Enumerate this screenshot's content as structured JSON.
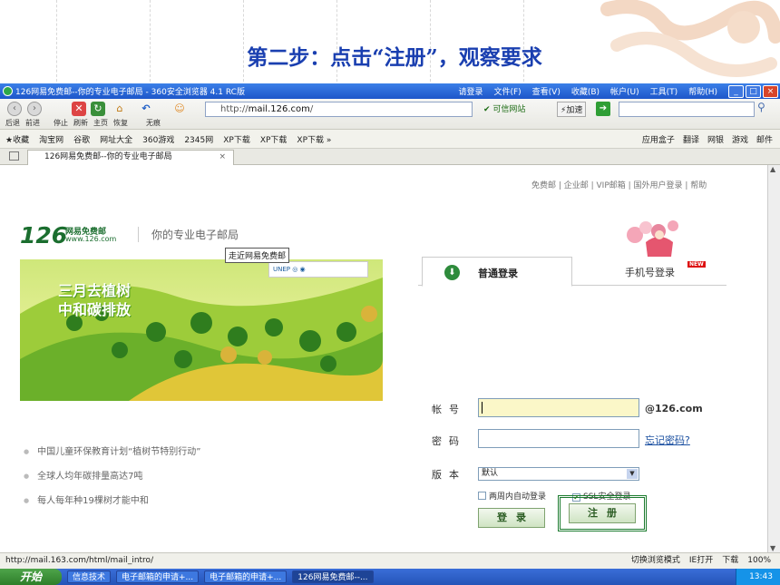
{
  "slide": {
    "title": "第二步：点击“注册”，观察要求"
  },
  "browser": {
    "window_title": "126网易免费邮--你的专业电子邮局 - 360安全浏览器 4.1 RC版",
    "menu": [
      "请登录",
      "文件(F)",
      "查看(V)",
      "收藏(B)",
      "帐户(U)",
      "工具(T)",
      "帮助(H)"
    ],
    "nav_labels": [
      "后退",
      "前进",
      "停止",
      "刷新",
      "主页",
      "恢复",
      "无痕"
    ],
    "address_prefix": "http://",
    "address_host": "mail.126.com",
    "address_suffix": "/",
    "trusted_site": "可信网站",
    "speedup": "加速",
    "favorites": [
      "收藏",
      "淘宝网",
      "谷歌",
      "网址大全",
      "360游戏",
      "2345网",
      "XP下载",
      "XP下载",
      "XP下载"
    ],
    "favorites_right": [
      "应用盒子",
      "翻译",
      "网银",
      "游戏",
      "邮件"
    ],
    "tab_title": "126网易免费邮--你的专业电子邮局",
    "status_url": "http://mail.163.com/html/mail_intro/",
    "status_right": [
      "切换浏览模式",
      "IE打开",
      "下载",
      "100%"
    ],
    "taskbar": {
      "start": "开始",
      "items": [
        "信息技术",
        "电子邮箱的申请+...",
        "电子邮箱的申请+...",
        "126网易免费邮--..."
      ],
      "clock": "13:43"
    }
  },
  "page": {
    "top_links": "免费邮 | 企业邮 | VIP邮箱 | 国外用户登录 | 帮助",
    "logo_number": "126",
    "logo_name": "网易免费邮",
    "logo_url": "www.126.com",
    "slogan": "你的专业电子邮局",
    "tooltip": "走近网易免费邮",
    "banner_line1": "三月去植树",
    "banner_line2": "中和碳排放",
    "bullets": [
      "中国儿童环保教育计划“植树节特别行动”",
      "全球人均年碳排量高达7吨",
      "每人每年种19棵树才能中和"
    ],
    "login": {
      "tab_normal": "普通登录",
      "tab_mobile": "手机号登录",
      "new_badge": "NEW",
      "account_label": "帐号",
      "account_suffix": "@126.com",
      "password_label": "密码",
      "forgot": "忘记密码?",
      "version_label": "版本",
      "version_value": "默认",
      "remember": "两周内自动登录",
      "ssl": "SSL安全登录",
      "login_button": "登录",
      "register_button": "注册"
    }
  }
}
